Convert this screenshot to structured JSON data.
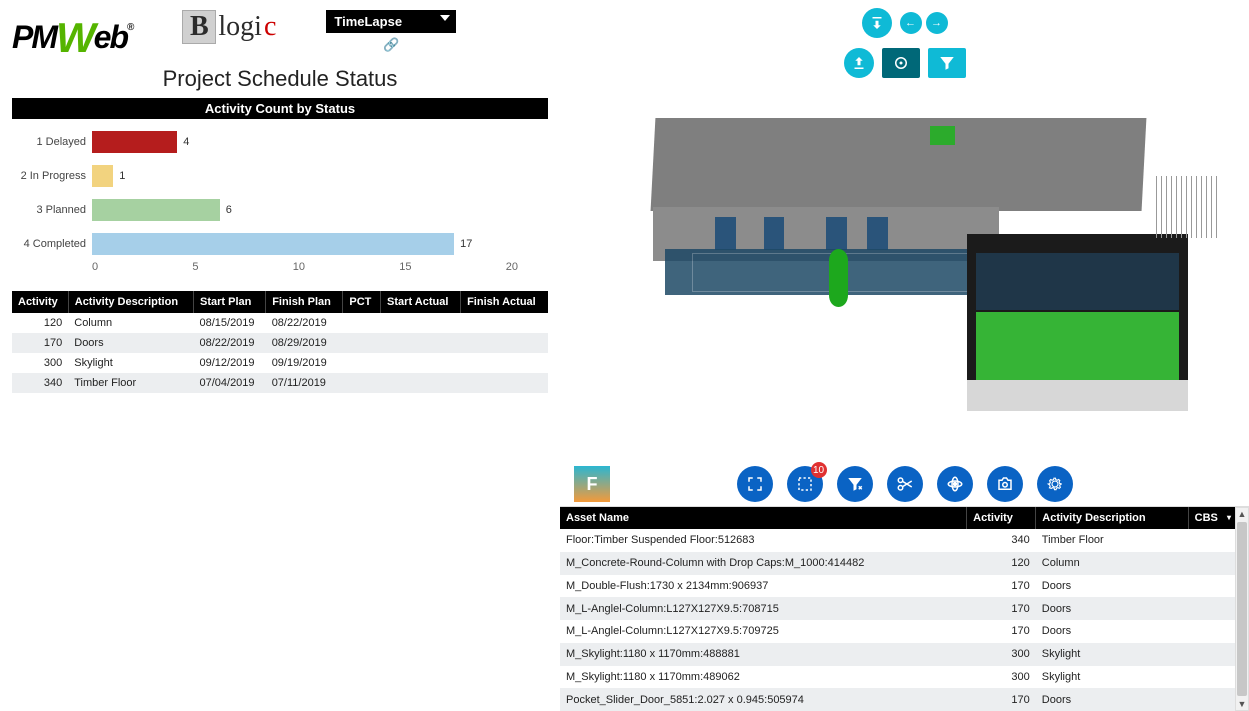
{
  "header": {
    "timelapse_label": "TimeLapse"
  },
  "project_title": "Project Schedule Status",
  "chart_data": {
    "type": "bar",
    "title": "Activity Count by Status",
    "orientation": "horizontal",
    "categories": [
      "1 Delayed",
      "2 In Progress",
      "3 Planned",
      "4 Completed"
    ],
    "values": [
      4,
      1,
      6,
      17
    ],
    "colors": [
      "#b51d1d",
      "#f2d37f",
      "#a6d1a1",
      "#a6cfe9"
    ],
    "xlabel": "",
    "ylabel": "",
    "xlim": [
      0,
      20
    ],
    "ticks": [
      0,
      5,
      10,
      15,
      20
    ]
  },
  "activity_table": {
    "headers": [
      "Activity",
      "Activity Description",
      "Start Plan",
      "Finish Plan",
      "PCT",
      "Start Actual",
      "Finish Actual"
    ],
    "rows": [
      {
        "activity": "120",
        "desc": "Column",
        "start": "08/15/2019",
        "finish": "08/22/2019",
        "pct": "",
        "sa": "",
        "fa": ""
      },
      {
        "activity": "170",
        "desc": "Doors",
        "start": "08/22/2019",
        "finish": "08/29/2019",
        "pct": "",
        "sa": "",
        "fa": ""
      },
      {
        "activity": "300",
        "desc": "Skylight",
        "start": "09/12/2019",
        "finish": "09/19/2019",
        "pct": "",
        "sa": "",
        "fa": ""
      },
      {
        "activity": "340",
        "desc": "Timber Floor",
        "start": "07/04/2019",
        "finish": "07/11/2019",
        "pct": "",
        "sa": "",
        "fa": ""
      }
    ]
  },
  "viewer_toolbar": {
    "badge_count": "10",
    "forge_label": "F"
  },
  "asset_table": {
    "headers": [
      "Asset Name",
      "Activity",
      "Activity Description",
      "CBS"
    ],
    "rows": [
      {
        "asset": "Floor:Timber Suspended Floor:512683",
        "activity": "340",
        "desc": "Timber Floor",
        "cbs": ""
      },
      {
        "asset": "M_Concrete-Round-Column with Drop Caps:M_1000:414482",
        "activity": "120",
        "desc": "Column",
        "cbs": ""
      },
      {
        "asset": "M_Double-Flush:1730 x 2134mm:906937",
        "activity": "170",
        "desc": "Doors",
        "cbs": ""
      },
      {
        "asset": "M_L-Anglel-Column:L127X127X9.5:708715",
        "activity": "170",
        "desc": "Doors",
        "cbs": ""
      },
      {
        "asset": "M_L-Anglel-Column:L127X127X9.5:709725",
        "activity": "170",
        "desc": "Doors",
        "cbs": ""
      },
      {
        "asset": "M_Skylight:1180 x 1170mm:488881",
        "activity": "300",
        "desc": "Skylight",
        "cbs": ""
      },
      {
        "asset": "M_Skylight:1180 x 1170mm:489062",
        "activity": "300",
        "desc": "Skylight",
        "cbs": ""
      },
      {
        "asset": "Pocket_Slider_Door_5851:2.027 x 0.945:505974",
        "activity": "170",
        "desc": "Doors",
        "cbs": ""
      }
    ]
  }
}
